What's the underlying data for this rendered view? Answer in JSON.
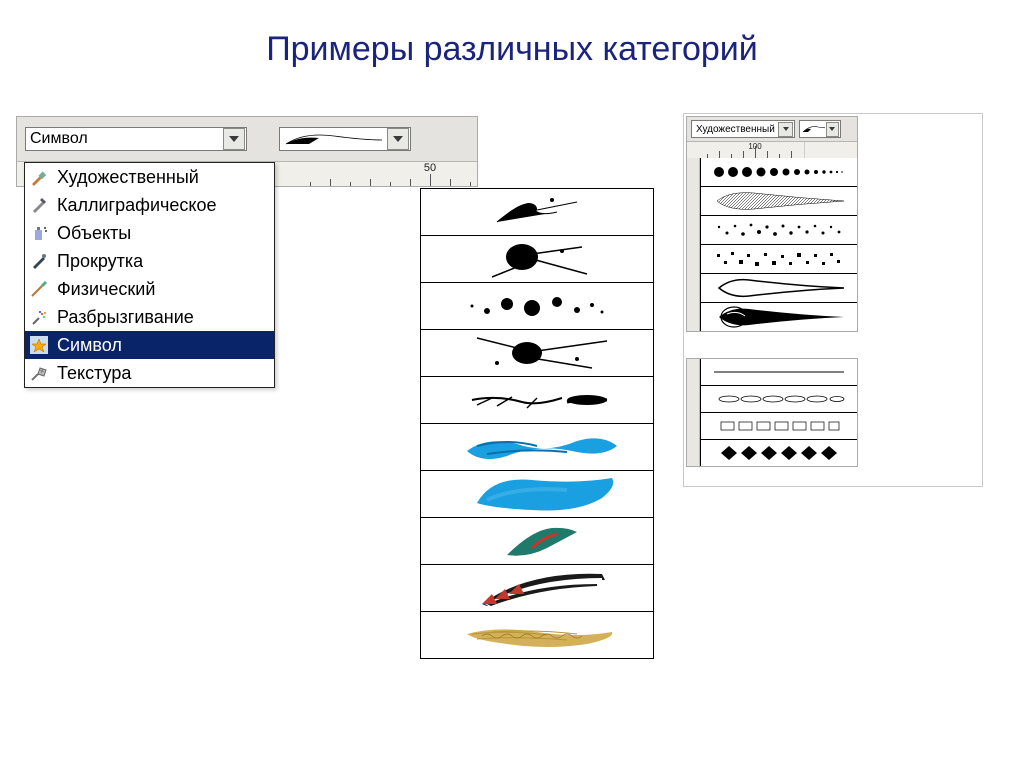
{
  "title": "Примеры различных категорий",
  "left": {
    "dropdown_value": "Символ",
    "ruler_mark": "50",
    "items": [
      {
        "label": "Художественный",
        "icon": "paintbrush"
      },
      {
        "label": "Каллиграфическое",
        "icon": "pen-nib"
      },
      {
        "label": "Объекты",
        "icon": "spray-can"
      },
      {
        "label": "Прокрутка",
        "icon": "pen"
      },
      {
        "label": "Физический",
        "icon": "brush-thin"
      },
      {
        "label": "Разбрызгивание",
        "icon": "spray"
      },
      {
        "label": "Символ",
        "icon": "star-shape",
        "selected": true
      },
      {
        "label": "Текстура",
        "icon": "texture"
      }
    ]
  },
  "center": {
    "brush_samples": [
      "splatter-1",
      "splatter-blob",
      "dots-spray",
      "splatter-2",
      "scratch",
      "wave-blue",
      "brush-blue",
      "feather-teal",
      "ship-flag",
      "rope-gold"
    ]
  },
  "right": {
    "dropdown_value": "Художественный",
    "ruler_mark": "100",
    "brush_samples_top": [
      "dots-row",
      "teardrop-hatch",
      "dots-scatter",
      "bars-scatter",
      "teardrop-outline",
      "teardrop-swirl"
    ],
    "brush_samples_bottom": [
      "divider",
      "ellipse-chain",
      "boxes-row",
      "diamond-row"
    ]
  }
}
